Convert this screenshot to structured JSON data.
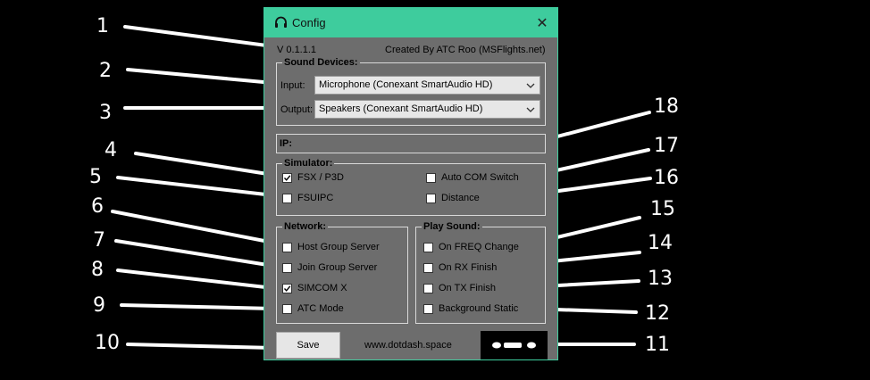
{
  "window": {
    "title": "Config",
    "close_glyph": "✕"
  },
  "header": {
    "version": "V 0.1.1.1",
    "credit": "Created By ATC Roo (MSFlights.net)"
  },
  "sound_devices": {
    "title": "Sound Devices:",
    "input_label": "Input:",
    "input_value": "Microphone (Conexant SmartAudio HD)",
    "output_label": "Output:",
    "output_value": "Speakers (Conexant SmartAudio HD)"
  },
  "ip": {
    "label": "IP:"
  },
  "simulator": {
    "title": "Simulator:",
    "fsx_p3d": {
      "label": "FSX / P3D",
      "checked": true
    },
    "fsuipc": {
      "label": "FSUIPC",
      "checked": false
    },
    "auto_com_switch": {
      "label": "Auto COM Switch",
      "checked": false
    },
    "distance": {
      "label": "Distance",
      "checked": false
    }
  },
  "network": {
    "title": "Network:",
    "host_group_server": {
      "label": "Host Group Server",
      "checked": false
    },
    "join_group_server": {
      "label": "Join Group Server",
      "checked": false
    },
    "simcom_x": {
      "label": "SIMCOM X",
      "checked": true
    },
    "atc_mode": {
      "label": "ATC Mode",
      "checked": false
    }
  },
  "play_sound": {
    "title": "Play Sound:",
    "on_freq_change": {
      "label": "On FREQ Change",
      "checked": false
    },
    "on_rx_finish": {
      "label": "On RX Finish",
      "checked": false
    },
    "on_tx_finish": {
      "label": "On TX Finish",
      "checked": false
    },
    "background_static": {
      "label": "Background Static",
      "checked": false
    }
  },
  "footer": {
    "save_label": "Save",
    "website": "www.dotdash.space"
  },
  "callouts": [
    "1",
    "2",
    "3",
    "4",
    "5",
    "6",
    "7",
    "8",
    "9",
    "10",
    "11",
    "12",
    "13",
    "14",
    "15",
    "16",
    "17",
    "18"
  ],
  "colors": {
    "titlebar": "#3ecc9d",
    "window_bg": "#6d6d6d",
    "background": "#000000"
  }
}
